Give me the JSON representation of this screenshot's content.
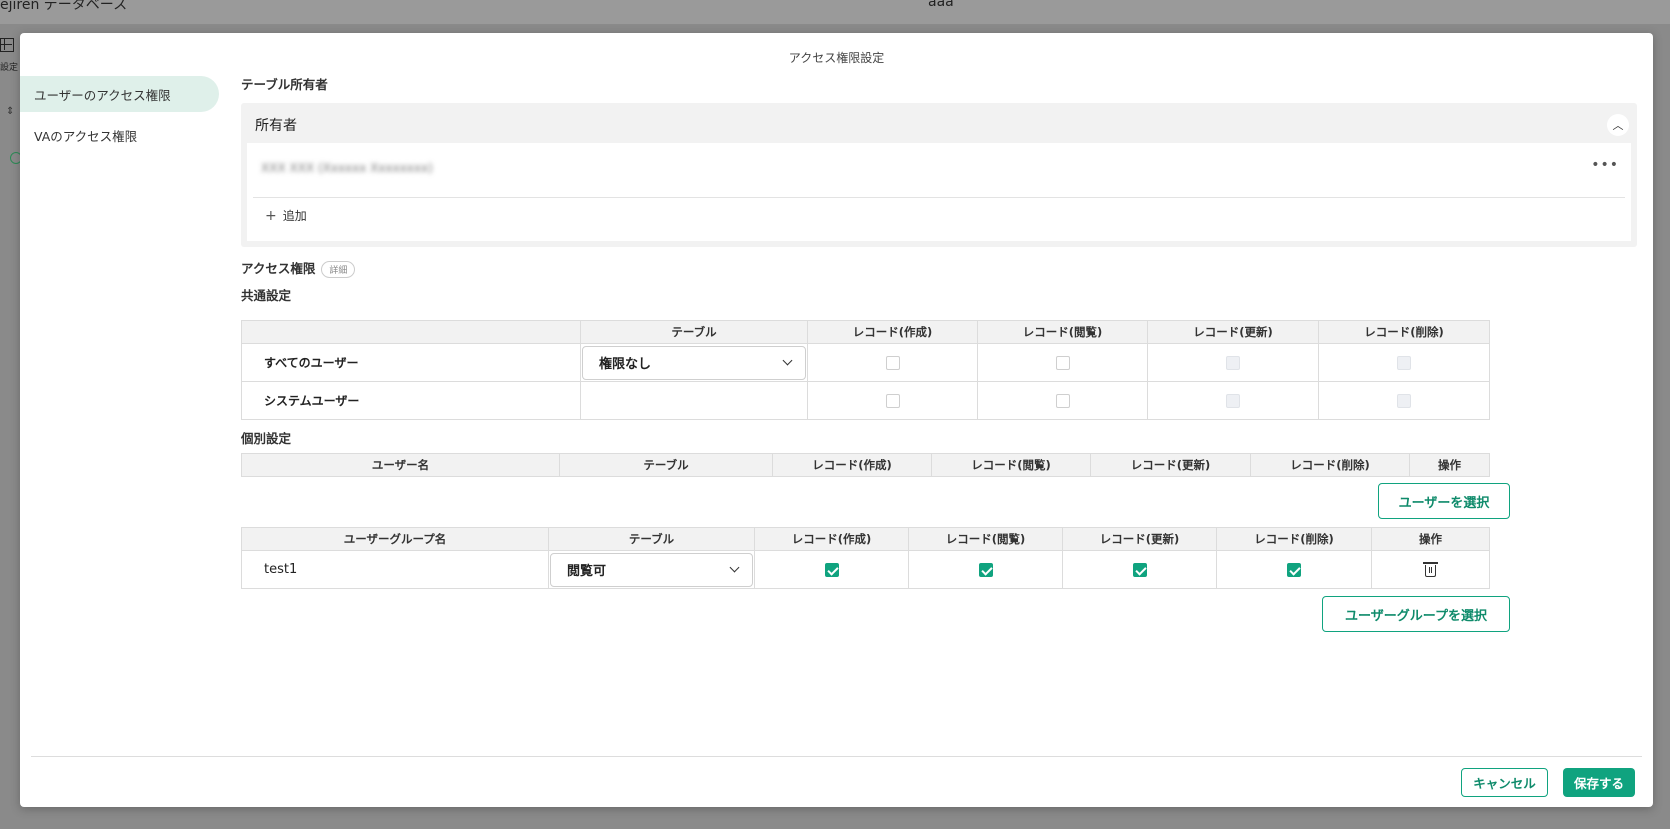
{
  "background": {
    "app_title": "ejiren データベース",
    "center_text": "aaa",
    "setting_label": "設定"
  },
  "modal": {
    "title": "アクセス権限設定",
    "sidebar": [
      {
        "label": "ユーザーのアクセス権限",
        "active": true
      },
      {
        "label": "VAのアクセス権限",
        "active": false
      }
    ],
    "owner_section": {
      "label": "テーブル所有者",
      "panel_title": "所有者",
      "owner_name": "XXX XXX (Xxxxxx Xxxxxxxx)",
      "add_label": "追加"
    },
    "access": {
      "label": "アクセス権限",
      "detail_badge": "詳細",
      "common_label": "共通設定",
      "common_headers": [
        "",
        "テーブル",
        "レコード(作成)",
        "レコード(閲覧)",
        "レコード(更新)",
        "レコード(削除)"
      ],
      "common_rows": [
        {
          "name": "すべてのユーザー",
          "table": "権限なし"
        },
        {
          "name": "システムユーザー",
          "table": ""
        }
      ],
      "individual_label": "個別設定",
      "user_headers": [
        "ユーザー名",
        "テーブル",
        "レコード(作成)",
        "レコード(閲覧)",
        "レコード(更新)",
        "レコード(削除)",
        "操作"
      ],
      "select_user_button": "ユーザーを選択",
      "group_headers": [
        "ユーザーグループ名",
        "テーブル",
        "レコード(作成)",
        "レコード(閲覧)",
        "レコード(更新)",
        "レコード(削除)",
        "操作"
      ],
      "group_rows": [
        {
          "name": "test1",
          "table": "閲覧可"
        }
      ],
      "select_group_button": "ユーザーグループを選択"
    },
    "footer": {
      "cancel": "キャンセル",
      "save": "保存する"
    }
  },
  "colors": {
    "accent": "#10a37f",
    "sidebar_active_bg": "#dff0ea"
  }
}
